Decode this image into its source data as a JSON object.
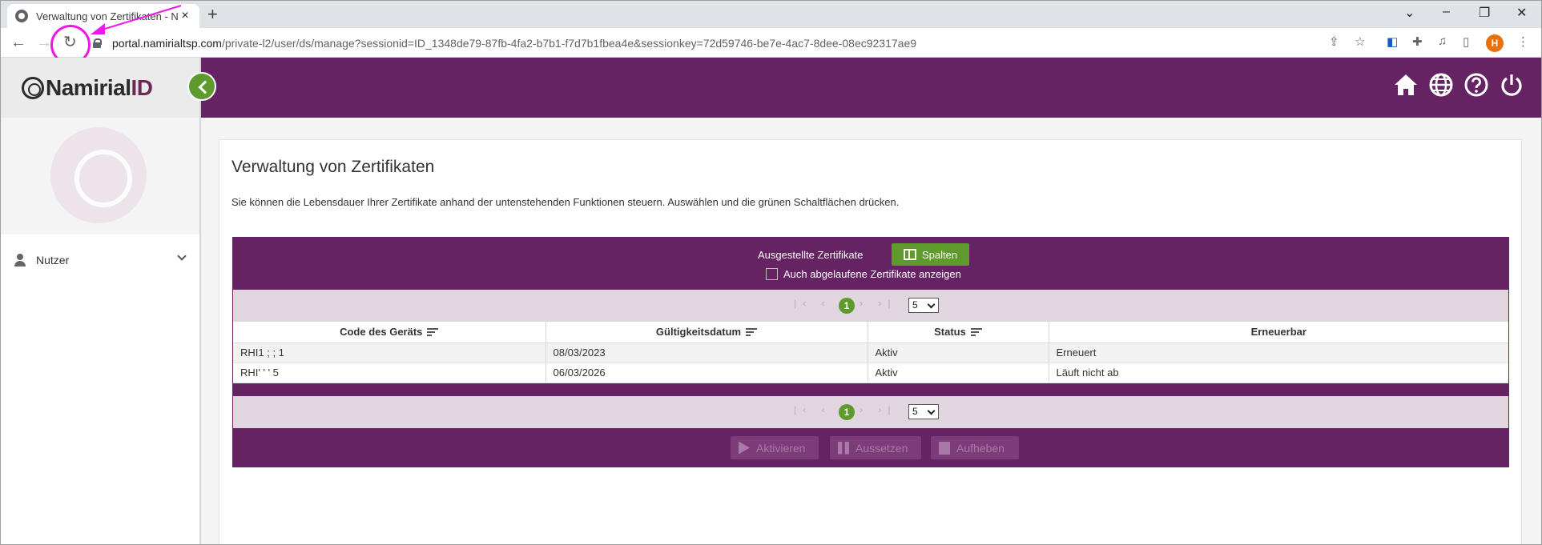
{
  "browser": {
    "tab_title": "Verwaltung von Zertifikaten - Na",
    "tab_close": "×",
    "new_tab": "+",
    "url_host": "portal.namirialtsp.com",
    "url_path": "/private-l2/user/ds/manage?sessionid=ID_1348de79-87fb-4fa2-b7b1-f7d7b1fbea4e&sessionkey=72d59746-be7e-4ac7-8dee-08ec92317ae9",
    "profile_initial": "H",
    "icons": [
      "back-icon",
      "forward-icon",
      "reload-icon",
      "lock-icon",
      "share-icon",
      "star-icon",
      "extension-icon",
      "puzzle-icon",
      "media-icon",
      "sidepanel-icon",
      "menu-icon"
    ],
    "annotation_color": "#ee18e8"
  },
  "app": {
    "logo_text": "Namirial",
    "logo_id": "ID",
    "brand_color": "#662363",
    "accent_color": "#5e9a2c",
    "sidebar": {
      "user_label": "Nutzer"
    },
    "header_icons": [
      "home-icon",
      "globe-icon",
      "help-icon",
      "power-icon"
    ]
  },
  "main": {
    "title": "Verwaltung von Zertifikaten",
    "description": "Sie können die Lebensdauer Ihrer Zertifikate anhand der untenstehenden Funktionen steuern. Auswählen und die grünen Schaltflächen drücken.",
    "panel": {
      "title": "Ausgestellte Zertifikate",
      "columns_button": "Spalten",
      "show_expired_label": "Auch abgelaufene Zertifikate anzeigen",
      "show_expired_checked": false
    },
    "pager": {
      "current_page": "1",
      "page_size": "5"
    },
    "table": {
      "headers": [
        "Code des Geräts",
        "Gültigkeitsdatum",
        "Status",
        "Erneuerbar"
      ],
      "rows": [
        [
          "RHI1    ;  ;  1",
          "08/03/2023",
          "Aktiv",
          "Erneuert"
        ],
        [
          "RHI'    ' '   5  ",
          "06/03/2026",
          "Aktiv",
          "Läuft nicht ab"
        ]
      ]
    },
    "actions": {
      "activate": "Aktivieren",
      "suspend": "Aussetzen",
      "revoke": "Aufheben"
    }
  }
}
